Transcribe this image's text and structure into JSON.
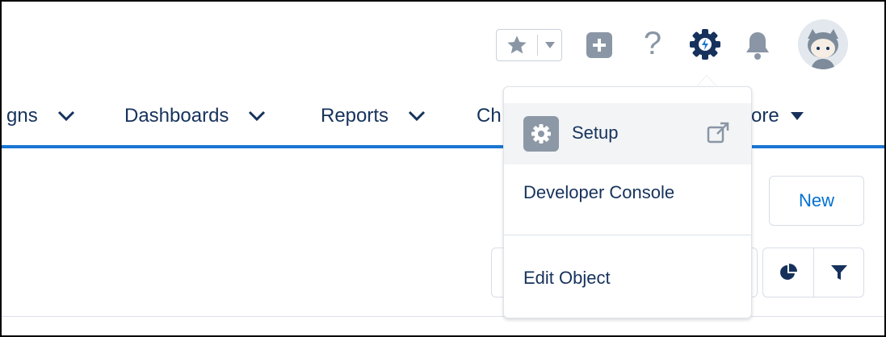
{
  "header": {
    "favorites_star_icon": "star-icon",
    "favorites_menu_icon": "chevron-down-icon",
    "global_actions_icon": "plus-icon",
    "help_text": "?",
    "setup_icon": "gear-icon",
    "notifications_icon": "bell-icon",
    "avatar_icon": "user-avatar"
  },
  "nav": {
    "items": [
      {
        "label": "gns"
      },
      {
        "label": "Dashboards"
      },
      {
        "label": "Reports"
      },
      {
        "label": "Ch"
      },
      {
        "label": "ore"
      }
    ]
  },
  "main": {
    "new_button": "New",
    "chart_icon": "pie-chart-icon",
    "filter_icon": "filter-icon"
  },
  "setup_menu": {
    "items": [
      {
        "label": "Setup",
        "icon": "gear-icon",
        "external": true
      },
      {
        "label": "Developer Console"
      },
      {
        "label": "Edit Object"
      }
    ]
  },
  "colors": {
    "accent_blue": "#1b76d3",
    "link_blue": "#0070d2",
    "text_navy": "#16325c",
    "icon_gray": "#8a96a5"
  }
}
